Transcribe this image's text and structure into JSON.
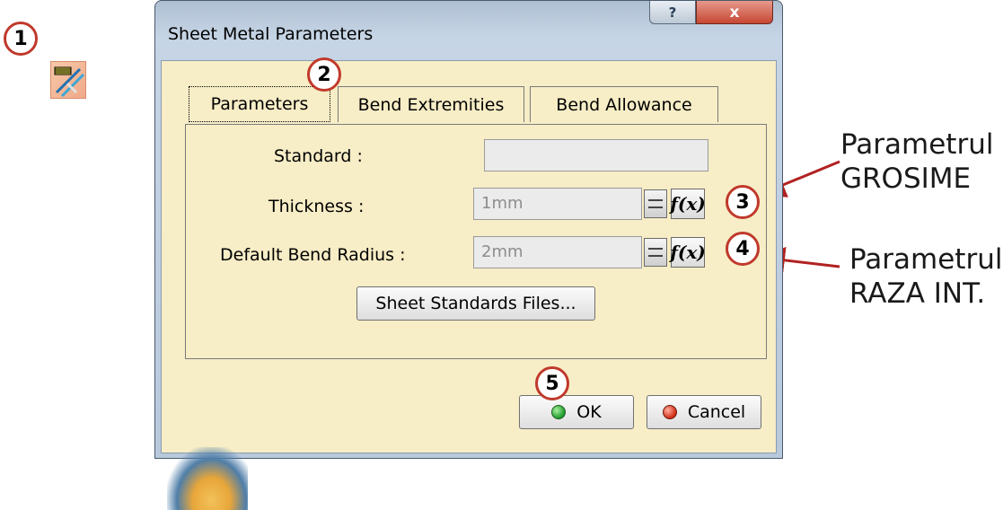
{
  "callouts": [
    "1",
    "2",
    "3",
    "4",
    "5"
  ],
  "annotations": {
    "grosime": [
      "Parametrul",
      "GROSIME"
    ],
    "raza": [
      "Parametrul",
      "RAZA INT."
    ]
  },
  "dialog": {
    "title": "Sheet Metal Parameters",
    "help_glyph": "?",
    "close_glyph": "x",
    "tabs": [
      "Parameters",
      "Bend Extremities",
      "Bend Allowance"
    ],
    "active_tab": "Parameters",
    "fields": {
      "standard": {
        "label": "Standard :",
        "value": ""
      },
      "thickness": {
        "label": "Thickness :",
        "value": "1mm"
      },
      "bend_radius": {
        "label": "Default Bend Radius :",
        "value": "2mm"
      }
    },
    "fx_label": "f(x)",
    "sheet_standards_button": "Sheet Standards Files...",
    "ok_label": "OK",
    "cancel_label": "Cancel"
  },
  "colors": {
    "callout_ring": "#c0392b",
    "dialog_body": "#f7edc6",
    "close_button": "#c74633"
  },
  "icons": [
    "sheet-metal-parameters-icon",
    "help-icon",
    "close-icon",
    "spinner-icon",
    "formula-icon",
    "green-status-icon",
    "red-status-icon"
  ]
}
